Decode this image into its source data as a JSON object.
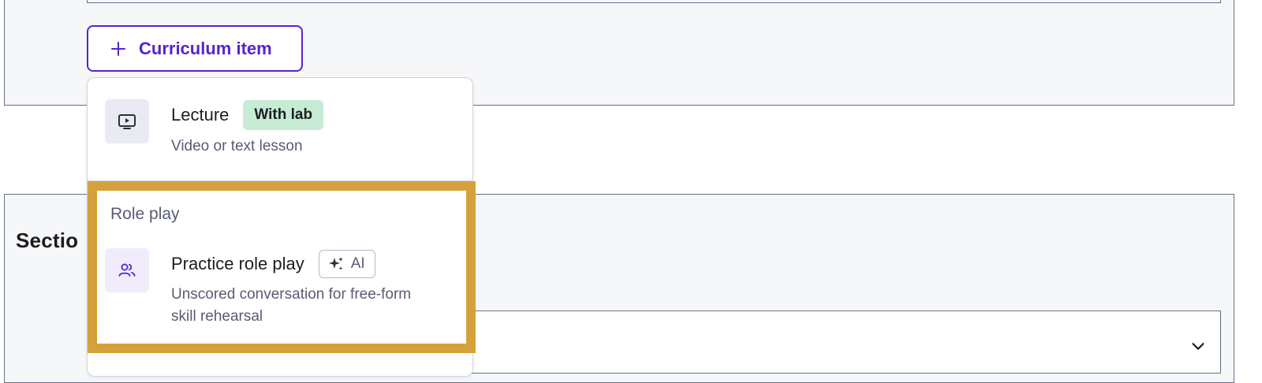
{
  "add_button": {
    "icon": "plus-icon",
    "label": "Curriculum item",
    "color": "#5624d0"
  },
  "section": {
    "label_visible": "Sectio"
  },
  "menu": {
    "lecture": {
      "icon": "video-screen-icon",
      "title": "Lecture",
      "badge": "With lab",
      "badge_color": "#c6ecd6",
      "description": "Video or text lesson"
    },
    "role_play_group": {
      "heading": "Role play"
    },
    "practice_role_play": {
      "icon": "users-icon",
      "title": "Practice role play",
      "badge": "AI",
      "badge_icon": "sparkle-icon",
      "description_line1": "Unscored conversation for free-form",
      "description_line2": "skill rehearsal"
    }
  },
  "highlight_color": "#d4a13a"
}
